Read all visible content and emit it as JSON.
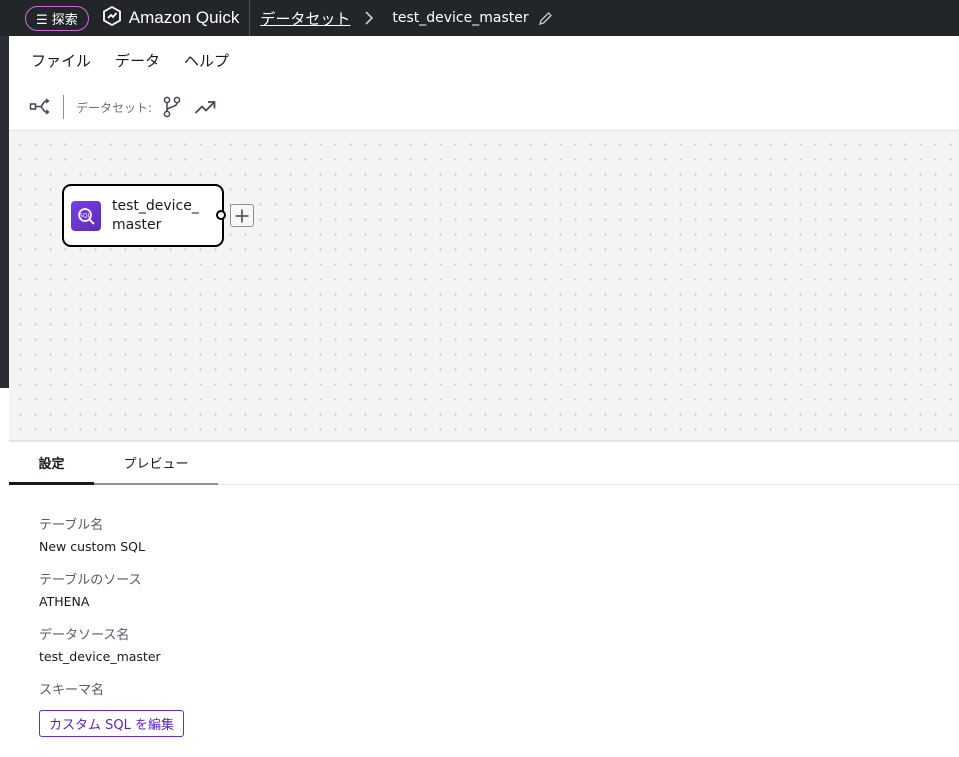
{
  "topbar": {
    "search_label": "☰ 探索",
    "logo_text": "Amazon Quick",
    "breadcrumb_link": "データセット",
    "breadcrumb_current": "test_device_master"
  },
  "menubar": {
    "items": [
      "ファイル",
      "データ",
      "ヘルプ"
    ]
  },
  "toolbar": {
    "dataset_label": "データセット:"
  },
  "canvas": {
    "node_label": "test_device_master"
  },
  "panel": {
    "tabs": [
      "設定",
      "プレビュー"
    ],
    "fields": [
      {
        "label": "テーブル名",
        "value": "New custom SQL"
      },
      {
        "label": "テーブルのソース",
        "value": "ATHENA"
      },
      {
        "label": "データソース名",
        "value": "test_device_master"
      },
      {
        "label": "スキーマ名",
        "value": ""
      }
    ],
    "edit_button": "カスタム SQL を編集"
  },
  "colors": {
    "topbar_bg": "#232629",
    "search_border": "#d26bd9",
    "accent_purple": "#6b2bd6",
    "node_icon": "#7b3fe4"
  },
  "icons": [
    "logo-icon",
    "chevron-right-icon",
    "pencil-icon",
    "share-graph-icon",
    "branch-icon",
    "trend-icon",
    "custom-sql-icon",
    "plus-icon"
  ]
}
